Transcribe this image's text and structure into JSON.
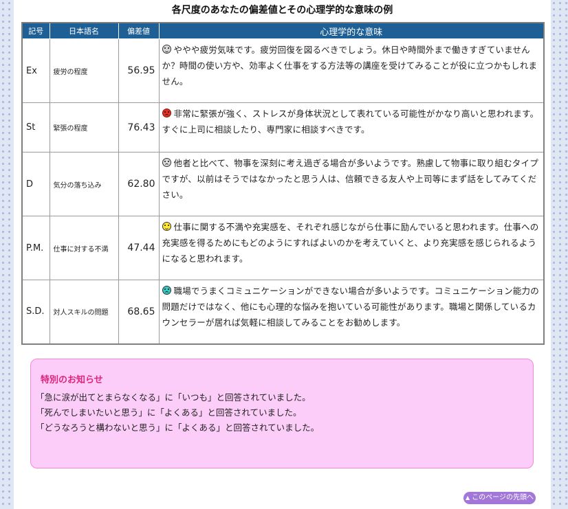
{
  "title": "各尺度のあなたの偏差値とその心理学的な意味の例",
  "table": {
    "headers": {
      "code": "記号",
      "name": "日本語名",
      "score": "偏差値",
      "meaning": "心理学的な意味"
    },
    "rows": [
      {
        "code": "Ex",
        "name": "疲労の程度",
        "score": "56.95",
        "icon": "grey-worried-face-icon",
        "meaning": "ややや疲労気味です。疲労回復を図るべきでしょう。休日や時間外まで働きすぎていませんか？時間の使い方や、効率よく仕事をする方法等の講座を受けてみることが役に立つかもしれません。"
      },
      {
        "code": "St",
        "name": "緊張の程度",
        "score": "76.43",
        "icon": "red-frowning-face-icon",
        "meaning": "非常に緊張が強く、ストレスが身体状況として表れている可能性がかなり高いと思われます。すぐに上司に相談したり、専門家に相談すべきです。"
      },
      {
        "code": "D",
        "name": "気分の落ち込み",
        "score": "62.80",
        "icon": "grey-worried-face-icon",
        "meaning": "他者と比べて、物事を深刻に考え過ぎる場合が多いようです。熟慮して物事に取り組むタイプですが、以前はそうではなかったと思う人は、信頼できる友人や上司等にまず話をしてみてください。"
      },
      {
        "code": "P.M.",
        "name": "仕事に対する不満",
        "score": "47.44",
        "icon": "yellow-smiling-face-icon",
        "meaning": "仕事に関する不満や充実感を、それぞれ感じながら仕事に励んでいると思われます。仕事への充実感を得るためにもどのようにすればよいのかを考えていくと、より充実感を感じられるようになると思われます。"
      },
      {
        "code": "S.D.",
        "name": "対人スキルの問題",
        "score": "68.65",
        "icon": "teal-frowning-face-icon",
        "meaning": "職場でうまくコミュニケーションができない場合が多いようです。コミュニケーション能力の問題だけではなく、他にも心理的な悩みを抱いている可能性があります。職場と関係しているカウンセラーが居れば気軽に相談してみることをお勧めします。"
      }
    ]
  },
  "notice": {
    "title": "特別のお知らせ",
    "lines": [
      "「急に涙が出てとまらなくなる」に「いつも」と回答されていました。",
      "「死んでしまいたいと思う」に「よくある」と回答されていました。",
      "「どうなろうと構わないと思う」に「よくある」と回答されていました。"
    ]
  },
  "back_to_top": {
    "arrow": "▲",
    "label": "このページの先頭へ"
  },
  "colors": {
    "header_bg": "#1e5f96",
    "notice_bg": "#fccdf8",
    "notice_title": "#e0247a",
    "button_bg": "#a277d8",
    "page_bg_dots": "#aab9dd"
  }
}
